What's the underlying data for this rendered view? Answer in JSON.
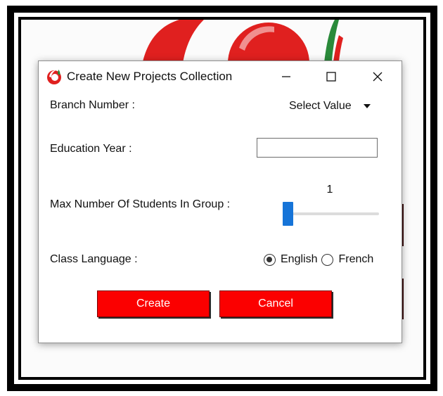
{
  "dialog": {
    "title": "Create New Projects Collection",
    "controls": {
      "minimize": "minimize-icon",
      "maximize": "maximize-icon",
      "close": "close-icon"
    }
  },
  "form": {
    "branch": {
      "label": "Branch Number :",
      "selected": "Select Value"
    },
    "year": {
      "label": "Education Year :",
      "value": ""
    },
    "max_students": {
      "label": "Max Number Of Students In Group :",
      "value": "1"
    },
    "language": {
      "label": "Class Language :",
      "options": [
        "English",
        "French"
      ],
      "selected": "English"
    }
  },
  "actions": {
    "create": "Create",
    "cancel": "Cancel"
  },
  "colors": {
    "button_red": "#fb0000",
    "slider_blue": "#1674d8",
    "logo_red": "#e0201f",
    "logo_green": "#2a8a3a"
  }
}
